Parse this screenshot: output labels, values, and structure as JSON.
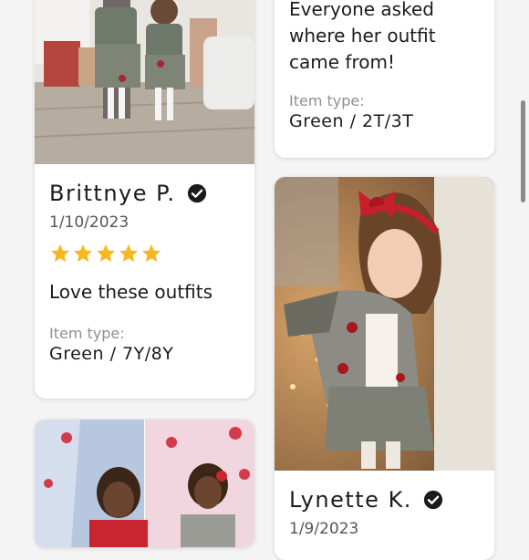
{
  "colors": {
    "star": "#f7b81f",
    "text": "#1b1b1b",
    "muted": "#8f8f8f"
  },
  "reviews": [
    {
      "name": "Brittnye P.",
      "date": "1/10/2023",
      "rating": 5,
      "text": "Love these outfits",
      "item_type_label": "Item type:",
      "item_type_value": "Green / 7Y/8Y",
      "photo_icon": "girls-in-houndstooth-outfits-photo"
    },
    {
      "text": "Everyone asked where her outfit came from!",
      "text_lines": [
        "Everyone asked",
        "where her outfit",
        "came from!"
      ],
      "item_type_label": "Item type:",
      "item_type_value": "Green / 2T/3T"
    },
    {
      "name": "Lynette K.",
      "date": "1/9/2023",
      "photo_icon": "girl-with-red-bow-photo"
    },
    {
      "photo_icon": "girl-christmas-tree-photo"
    }
  ],
  "icons": {
    "verified": "verified-check-icon",
    "star": "star-icon"
  }
}
